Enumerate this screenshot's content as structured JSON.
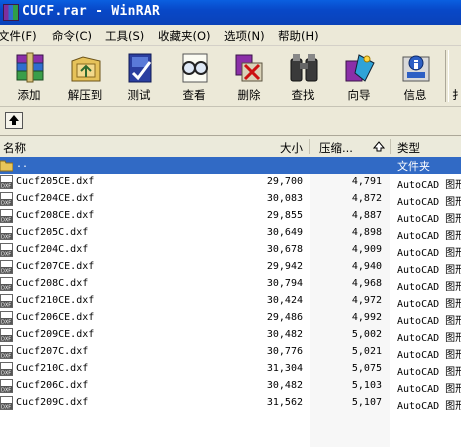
{
  "window": {
    "title": "CUCF.rar - WinRAR"
  },
  "menu": [
    "文件(F)",
    "命令(C)",
    "工具(S)",
    "收藏夹(O)",
    "选项(N)",
    "帮助(H)"
  ],
  "toolbar": [
    {
      "label": "添加",
      "icon": "add-archive-icon"
    },
    {
      "label": "解压到",
      "icon": "extract-to-icon"
    },
    {
      "label": "测试",
      "icon": "test-icon"
    },
    {
      "label": "查看",
      "icon": "view-icon"
    },
    {
      "label": "删除",
      "icon": "delete-icon"
    },
    {
      "label": "查找",
      "icon": "find-icon"
    },
    {
      "label": "向导",
      "icon": "wizard-icon"
    },
    {
      "label": "信息",
      "icon": "info-icon"
    },
    {
      "label": "扌",
      "icon": "partial-tool-icon"
    }
  ],
  "columns": {
    "name": "名称",
    "size": "大小",
    "packed": "压缩...",
    "type": "类型"
  },
  "parent_row": {
    "name": "..",
    "type": "文件夹"
  },
  "files": [
    {
      "name": "Cucf205CE.dxf",
      "size": "29,700",
      "packed": "4,791",
      "type": "AutoCAD 图形"
    },
    {
      "name": "Cucf204CE.dxf",
      "size": "30,083",
      "packed": "4,872",
      "type": "AutoCAD 图形"
    },
    {
      "name": "Cucf208CE.dxf",
      "size": "29,855",
      "packed": "4,887",
      "type": "AutoCAD 图形"
    },
    {
      "name": "Cucf205C.dxf",
      "size": "30,649",
      "packed": "4,898",
      "type": "AutoCAD 图形"
    },
    {
      "name": "Cucf204C.dxf",
      "size": "30,678",
      "packed": "4,909",
      "type": "AutoCAD 图形"
    },
    {
      "name": "Cucf207CE.dxf",
      "size": "29,942",
      "packed": "4,940",
      "type": "AutoCAD 图形"
    },
    {
      "name": "Cucf208C.dxf",
      "size": "30,794",
      "packed": "4,968",
      "type": "AutoCAD 图形"
    },
    {
      "name": "Cucf210CE.dxf",
      "size": "30,424",
      "packed": "4,972",
      "type": "AutoCAD 图形"
    },
    {
      "name": "Cucf206CE.dxf",
      "size": "29,486",
      "packed": "4,992",
      "type": "AutoCAD 图形"
    },
    {
      "name": "Cucf209CE.dxf",
      "size": "30,482",
      "packed": "5,002",
      "type": "AutoCAD 图形"
    },
    {
      "name": "Cucf207C.dxf",
      "size": "30,776",
      "packed": "5,021",
      "type": "AutoCAD 图形"
    },
    {
      "name": "Cucf210C.dxf",
      "size": "31,304",
      "packed": "5,075",
      "type": "AutoCAD 图形"
    },
    {
      "name": "Cucf206C.dxf",
      "size": "30,482",
      "packed": "5,103",
      "type": "AutoCAD 图形"
    },
    {
      "name": "Cucf209C.dxf",
      "size": "31,562",
      "packed": "5,107",
      "type": "AutoCAD 图形"
    }
  ]
}
